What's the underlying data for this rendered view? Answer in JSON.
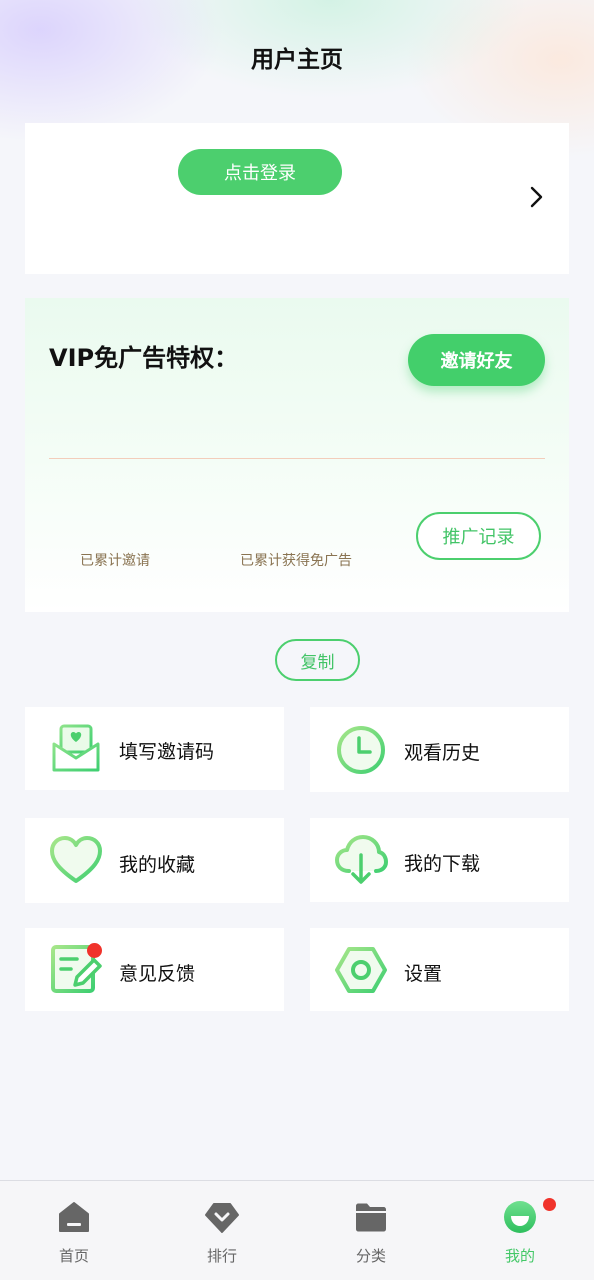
{
  "header": {
    "title": "用户主页"
  },
  "login_card": {
    "login_label": "点击登录"
  },
  "vip": {
    "title": "VIP免广告特权：",
    "invite_label": "邀请好友",
    "stat_invited_label": "已累计邀请",
    "stat_adfree_label": "已累计获得免广告",
    "promo_label": "推广记录"
  },
  "copy_label": "复制",
  "menu": {
    "items": [
      {
        "label": "填写邀请码",
        "icon": "envelope-heart-icon"
      },
      {
        "label": "观看历史",
        "icon": "clock-icon"
      },
      {
        "label": "我的收藏",
        "icon": "heart-icon"
      },
      {
        "label": "我的下载",
        "icon": "cloud-download-icon"
      },
      {
        "label": "意见反馈",
        "icon": "edit-icon"
      },
      {
        "label": "设置",
        "icon": "gear-icon"
      }
    ]
  },
  "bottom_nav": {
    "items": [
      {
        "label": "首页",
        "icon": "home-icon",
        "active": false
      },
      {
        "label": "排行",
        "icon": "ranking-icon",
        "active": false
      },
      {
        "label": "分类",
        "icon": "folder-icon",
        "active": false
      },
      {
        "label": "我的",
        "icon": "smile-icon",
        "active": true
      }
    ]
  },
  "colors": {
    "accent": "#4ccf6e",
    "badge": "#f0332b",
    "active_tab": "#44c868"
  }
}
